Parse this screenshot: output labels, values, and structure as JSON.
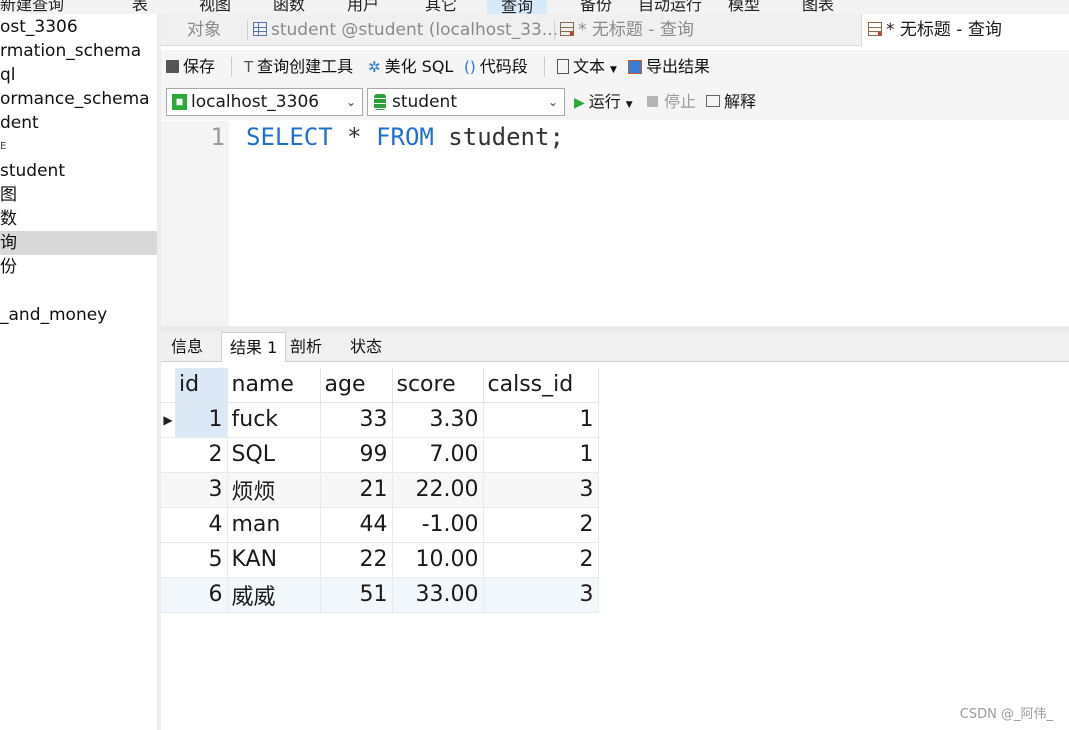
{
  "top_menu": [
    {
      "label": "新建查询"
    },
    {
      "label": "表"
    },
    {
      "label": "视图"
    },
    {
      "label": "函数"
    },
    {
      "label": "用户"
    },
    {
      "label": "其它"
    },
    {
      "label": "查询",
      "active": true
    },
    {
      "label": "备份"
    },
    {
      "label": "自动运行"
    },
    {
      "label": "模型"
    },
    {
      "label": "图表"
    }
  ],
  "sidebar": {
    "items": [
      {
        "label": "ost_3306"
      },
      {
        "label": "rmation_schema"
      },
      {
        "label": "ql"
      },
      {
        "label": "ormance_schema"
      },
      {
        "label": "dent"
      },
      {
        "label": "E"
      },
      {
        "label": "student"
      },
      {
        "label": "图"
      },
      {
        "label": "数"
      },
      {
        "label": "询",
        "selected": true
      },
      {
        "label": "份"
      },
      {
        "label": ""
      },
      {
        "label": "_and_money"
      }
    ]
  },
  "tabs": [
    {
      "label": "对象"
    },
    {
      "label": "student @student (localhost_33..."
    },
    {
      "label": "* 无标题 - 查询"
    },
    {
      "label": "* 无标题 - 查询",
      "active": true
    }
  ],
  "toolbar": {
    "save": "保存",
    "query_builder": "查询创建工具",
    "beautify": "美化 SQL",
    "snippet": "代码段",
    "text": "文本",
    "export": "导出结果"
  },
  "connection": {
    "host": "localhost_3306",
    "database": "student",
    "run": "运行",
    "stop": "停止",
    "explain": "解释"
  },
  "editor": {
    "line_number": "1",
    "kw1": "SELECT",
    "star": " * ",
    "kw2": "FROM",
    "rest": " student;"
  },
  "result_tabs": [
    {
      "label": "信息"
    },
    {
      "label": "结果 1",
      "active": true
    },
    {
      "label": "剖析"
    },
    {
      "label": "状态"
    }
  ],
  "result": {
    "columns": [
      "id",
      "name",
      "age",
      "score",
      "calss_id"
    ],
    "rows": [
      [
        "1",
        "fuck",
        "33",
        "3.30",
        "1"
      ],
      [
        "2",
        "SQL",
        "99",
        "7.00",
        "1"
      ],
      [
        "3",
        "烦烦",
        "21",
        "22.00",
        "3"
      ],
      [
        "4",
        "man",
        "44",
        "-1.00",
        "2"
      ],
      [
        "5",
        "KAN",
        "22",
        "10.00",
        "2"
      ],
      [
        "6",
        "威威",
        "51",
        "33.00",
        "3"
      ]
    ]
  },
  "watermark": "CSDN @_阿伟_",
  "colors": {
    "keyword": "#1f6fd1",
    "selection": "#dbe9f6",
    "run_green": "#2eaa3a",
    "db_green": "#2e9e3a"
  }
}
